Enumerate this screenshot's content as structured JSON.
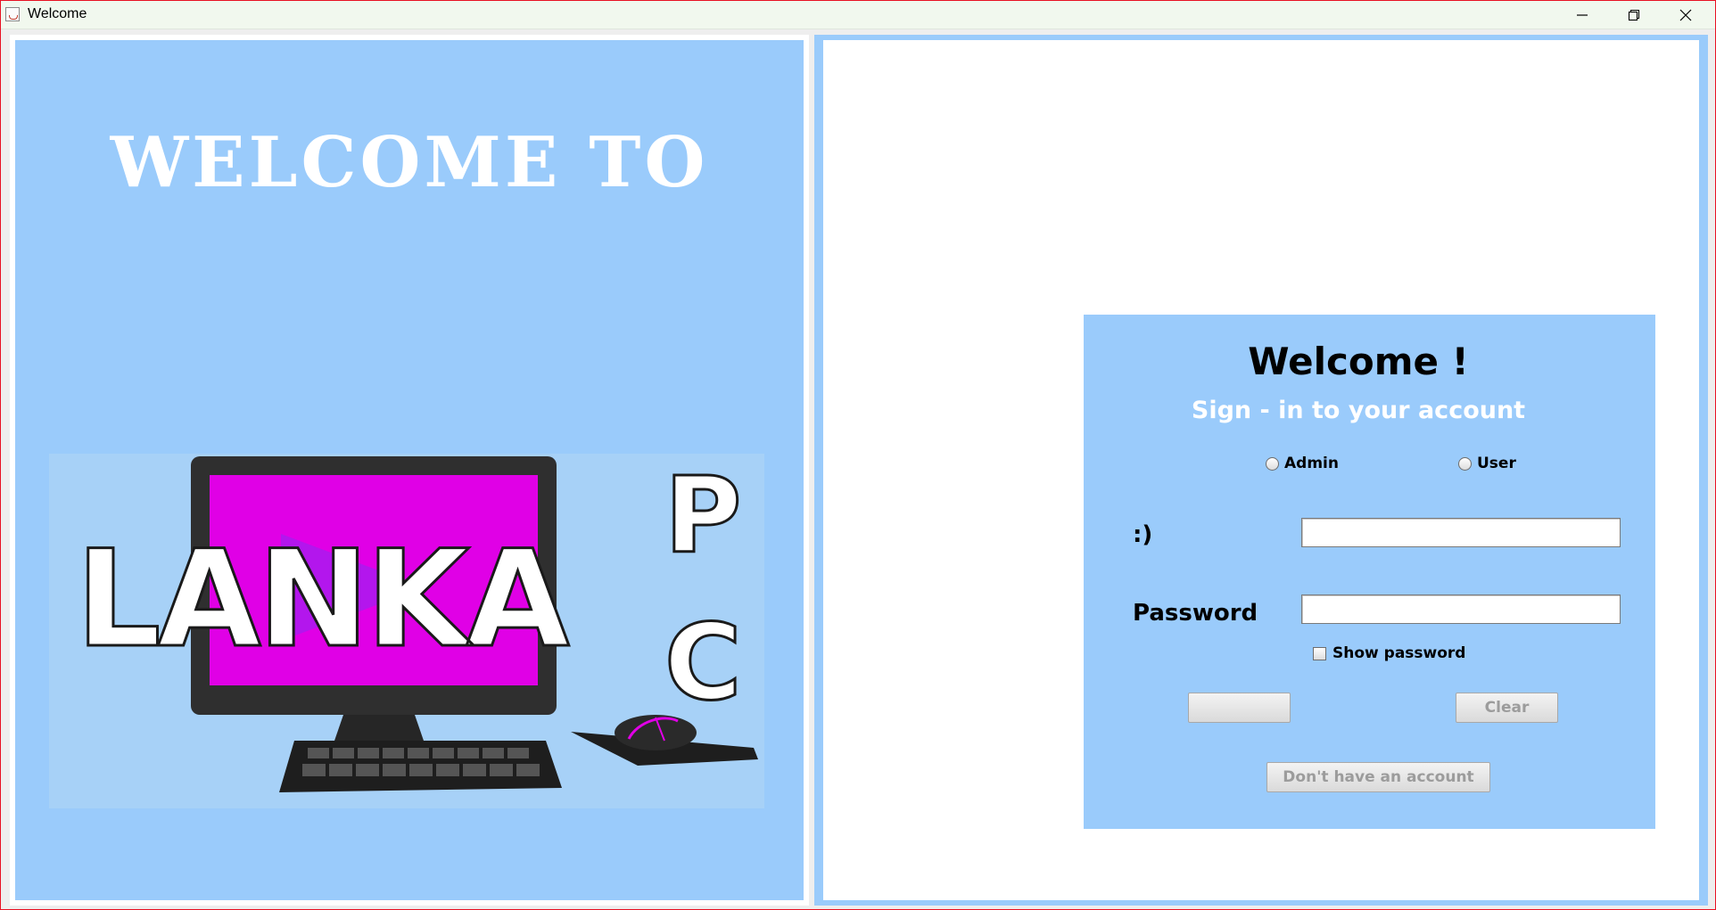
{
  "window": {
    "title": "Welcome",
    "controls": [
      "minimize-icon",
      "restore-icon",
      "close-icon"
    ]
  },
  "left": {
    "heading": "WELCOME TO",
    "logo": {
      "word": "LANKA",
      "side_letters": [
        "P",
        "C"
      ]
    }
  },
  "login": {
    "title": "Welcome !",
    "subtitle": "Sign - in to your account",
    "roles": [
      {
        "label": "Admin",
        "selected": false
      },
      {
        "label": "User",
        "selected": false
      }
    ],
    "username_label": ":)",
    "username_value": "",
    "password_label": "Password",
    "password_value": "",
    "show_password_label": "Show password",
    "show_password_checked": false,
    "login_button_label": "",
    "clear_button_label": "Clear",
    "signup_button_label": "Don't have an account"
  },
  "colors": {
    "panel_blue": "#9acbfb",
    "screen_magenta": "#e000e6",
    "monitor_dark": "#2f2f2f"
  }
}
